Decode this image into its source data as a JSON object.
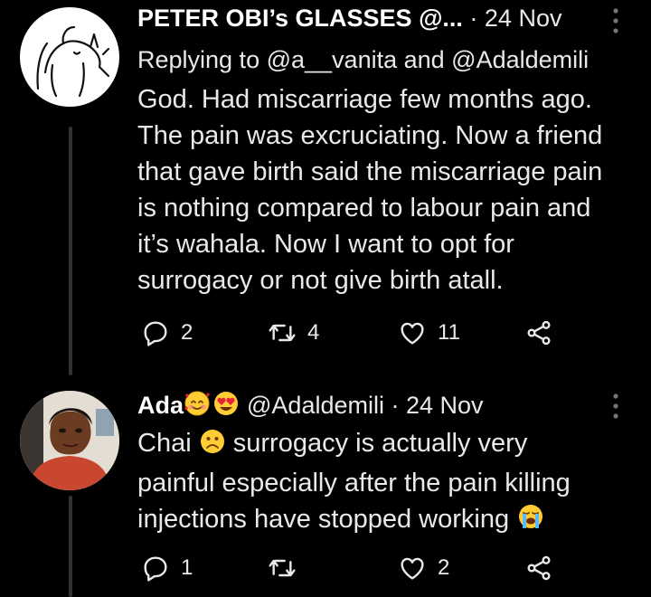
{
  "tweets": [
    {
      "display_name": "PETER OBI’s GLASSES @...",
      "separator": " · ",
      "time": "24 Nov",
      "reply_prefix": "Replying to ",
      "reply_to_1": "@a__vanita",
      "reply_and": " and ",
      "reply_to_2": "@Adaldemili",
      "text": "God. Had miscarriage few months ago.\nThe pain was excruciating. Now a friend\nthat gave birth said the miscarriage pain\nis nothing compared to labour pain and\nit’s wahala. Now I want to opt for\nsurrogacy or not give birth atall.",
      "replies": "2",
      "retweets": "4",
      "likes": "11",
      "avatar_icon": "sketch-drawing-avatar"
    },
    {
      "display_name": "Ada",
      "handle": "@Adaldemili",
      "separator": " · ",
      "time": "24 Nov",
      "text_part1": "Chai ",
      "text_part2": " surrogacy is actually very\npainful especially after the pain killing\ninjections have stopped working ",
      "replies": "1",
      "retweets": "",
      "likes": "2",
      "avatar_icon": "user-photo-avatar"
    }
  ],
  "colors": {
    "background": "#000000",
    "text": "#e7e9ea",
    "thread_line": "#2f3336",
    "icon": "#71767b"
  }
}
